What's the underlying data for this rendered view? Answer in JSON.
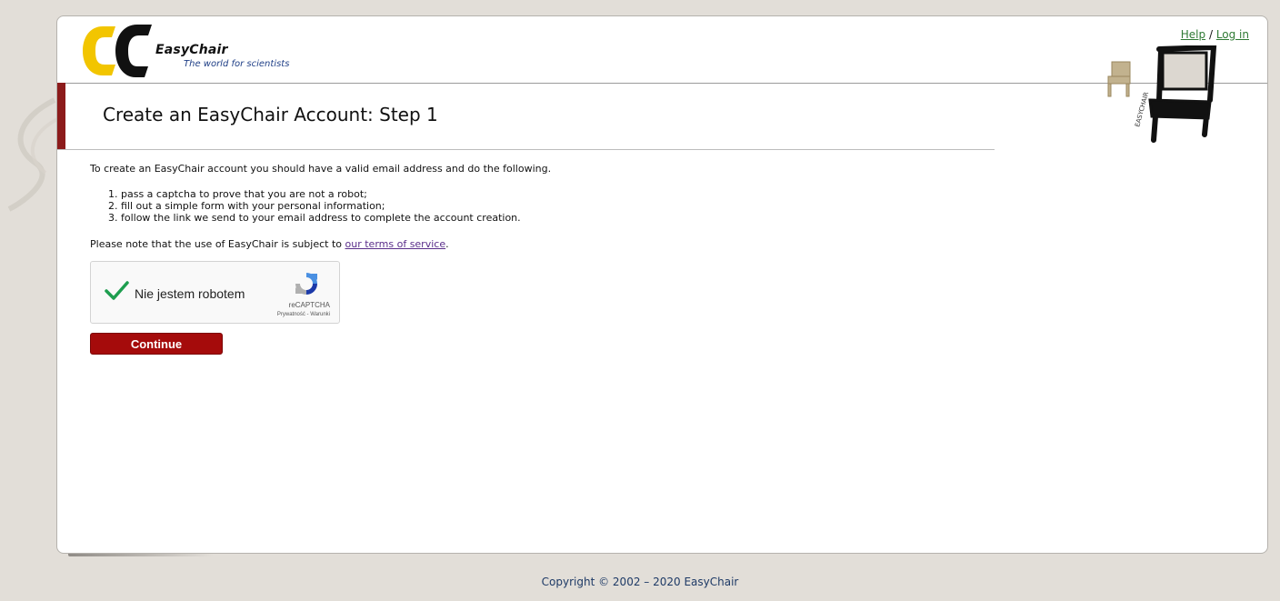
{
  "header": {
    "logo_name": "EasyChair",
    "logo_tagline": "The world for scientists",
    "help_label": "Help",
    "separator": "/",
    "login_label": "Log in"
  },
  "title": "Create an EasyChair Account: Step 1",
  "content": {
    "intro": "To create an EasyChair account you should have a valid email address and do the following.",
    "steps": [
      "1. pass a captcha to prove that you are not a robot;",
      "2. fill out a simple form with your personal information;",
      "3. follow the link we send to your email address to complete the account creation."
    ],
    "note_prefix": "Please note that the use of EasyChair is subject to ",
    "terms_link": "our terms of service",
    "note_suffix": "."
  },
  "captcha": {
    "label": "Nie jestem robotem",
    "checked": true,
    "brand": "reCAPTCHA",
    "links": "Prywatność - Warunki"
  },
  "continue_label": "Continue",
  "footer": "Copyright © 2002 – 2020 EasyChair",
  "colors": {
    "accent": "#a50b0b",
    "link_header": "#2f7a34",
    "link_body": "#5a2e8a",
    "footer_text": "#1e3a66",
    "logo_yellow": "#f2c500"
  }
}
